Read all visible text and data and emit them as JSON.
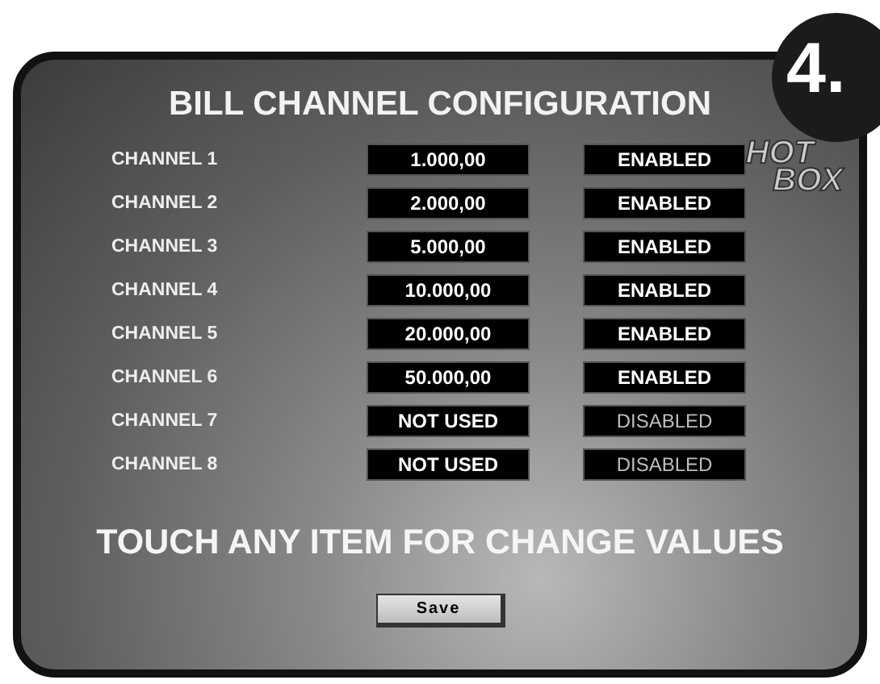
{
  "step_badge": "4.",
  "title": "BILL CHANNEL CONFIGURATION",
  "logo": {
    "line_1": "HOT",
    "line_2": "BOX"
  },
  "channels": [
    {
      "name": "CHANNEL 1",
      "value": "1.000,00",
      "status": "ENABLED",
      "enabled": true
    },
    {
      "name": "CHANNEL 2",
      "value": "2.000,00",
      "status": "ENABLED",
      "enabled": true
    },
    {
      "name": "CHANNEL 3",
      "value": "5.000,00",
      "status": "ENABLED",
      "enabled": true
    },
    {
      "name": "CHANNEL 4",
      "value": "10.000,00",
      "status": "ENABLED",
      "enabled": true
    },
    {
      "name": "CHANNEL 5",
      "value": "20.000,00",
      "status": "ENABLED",
      "enabled": true
    },
    {
      "name": "CHANNEL 6",
      "value": "50.000,00",
      "status": "ENABLED",
      "enabled": true
    },
    {
      "name": "CHANNEL 7",
      "value": "NOT USED",
      "status": "DISABLED",
      "enabled": false
    },
    {
      "name": "CHANNEL 8",
      "value": "NOT USED",
      "status": "DISABLED",
      "enabled": false
    }
  ],
  "instruction": "TOUCH ANY ITEM FOR CHANGE VALUES",
  "buttons": [
    "Save"
  ]
}
